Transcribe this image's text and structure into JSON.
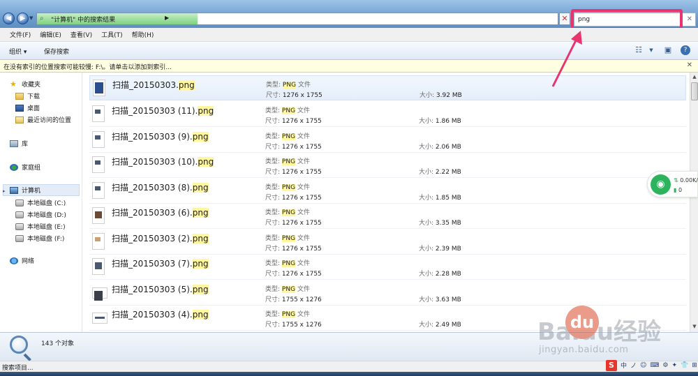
{
  "address": {
    "breadcrumb": "\"计算机\" 中的搜索结果",
    "search_value": "png"
  },
  "menu": [
    "文件(F)",
    "编辑(E)",
    "查看(V)",
    "工具(T)",
    "帮助(H)"
  ],
  "toolbar": {
    "organize": "组织 ▾",
    "save_search": "保存搜索"
  },
  "infobar": {
    "text": "在没有索引的位置搜索可能较慢: F:\\。请单击以添加到索引..."
  },
  "nav": {
    "favorites": "收藏夹",
    "downloads": "下载",
    "desktop": "桌面",
    "recent": "最近访问的位置",
    "libraries": "库",
    "homegroup": "家庭组",
    "computer": "计算机",
    "drive_c": "本地磁盘 (C:)",
    "drive_d": "本地磁盘 (D:)",
    "drive_e": "本地磁盘 (E:)",
    "drive_f": "本地磁盘 (F:)",
    "network": "网络"
  },
  "labels": {
    "type": "类型:",
    "dims": "尺寸:",
    "size": "大小:",
    "ext": "png",
    "ext_type": "PNG",
    "file_word": "文件"
  },
  "files": [
    {
      "name": "扫描_20150303.",
      "dims": "1276 x 1755",
      "size": "3.92 MB"
    },
    {
      "name": "扫描_20150303 (11).",
      "dims": "1276 x 1755",
      "size": "1.86 MB"
    },
    {
      "name": "扫描_20150303 (9).",
      "dims": "1276 x 1755",
      "size": "2.06 MB"
    },
    {
      "name": "扫描_20150303 (10).",
      "dims": "1276 x 1755",
      "size": "2.22 MB"
    },
    {
      "name": "扫描_20150303 (8).",
      "dims": "1276 x 1755",
      "size": "1.85 MB"
    },
    {
      "name": "扫描_20150303 (6).",
      "dims": "1276 x 1755",
      "size": "3.35 MB"
    },
    {
      "name": "扫描_20150303 (2).",
      "dims": "1276 x 1755",
      "size": "2.39 MB"
    },
    {
      "name": "扫描_20150303 (7).",
      "dims": "1276 x 1755",
      "size": "2.28 MB"
    },
    {
      "name": "扫描_20150303 (5).",
      "dims": "1755 x 1276",
      "size": "3.63 MB"
    },
    {
      "name": "扫描_20150303 (4).",
      "dims": "1755 x 1276",
      "size": "2.49 MB"
    }
  ],
  "wifi": {
    "speed": "0.00K/s",
    "devices": "0"
  },
  "details": {
    "count": "143 个对象"
  },
  "status": {
    "text": "搜索项目..."
  },
  "ime": {
    "s": "S",
    "zh": "中",
    "items": [
      "ノ",
      "☺",
      "⌨",
      "⚙",
      "✦",
      "👕",
      "⊞"
    ]
  },
  "watermark": {
    "brand": "Baidu经验",
    "url": "jingyan.baidu.com",
    "paw": "du"
  },
  "colors": {
    "highlight_box": "#e8346f",
    "match": "#fff6a0",
    "wifi_green": "#2db35d"
  }
}
